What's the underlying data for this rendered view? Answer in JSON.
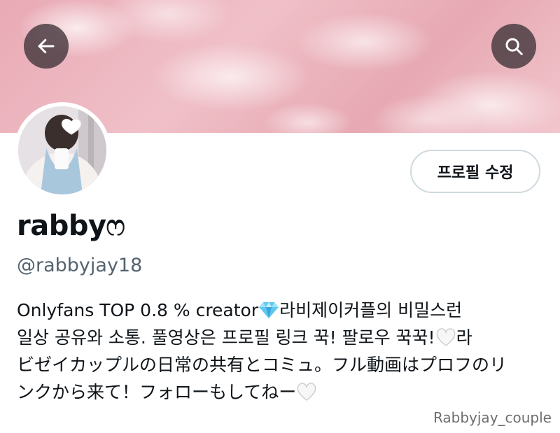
{
  "header": {
    "back_icon": "arrow-left-icon",
    "search_icon": "search-icon"
  },
  "profile": {
    "edit_button_label": "프로필 수정",
    "display_name": "rabby",
    "display_name_suffix": "ෆ",
    "handle": "@rabbyjay18",
    "bio": {
      "line1_text": "Onlyfans TOP 0.8 % creator",
      "line1_emoji": "gem-stone-icon",
      "line1_tail": "라비제이커플의 비밀스런",
      "line2_text": "일상 공유와 소통. 풀영상은 프로필 링크 꾹! 팔로우 꾹꾹!",
      "line2_emoji": "white-heart-icon",
      "line2_tail": "라",
      "line3_text": "ビゼイカップルの日常の共有とコミュ。フル動画はプロフのリ",
      "line4_text": "ンクから来て！フォローもしてねー",
      "line4_emoji": "white-heart-icon"
    }
  },
  "watermark": "Rabbyjay_couple",
  "colors": {
    "banner_pink": "#e9aab5",
    "text_primary": "#0f1419",
    "text_secondary": "#536471",
    "button_border": "#cfd9de"
  }
}
